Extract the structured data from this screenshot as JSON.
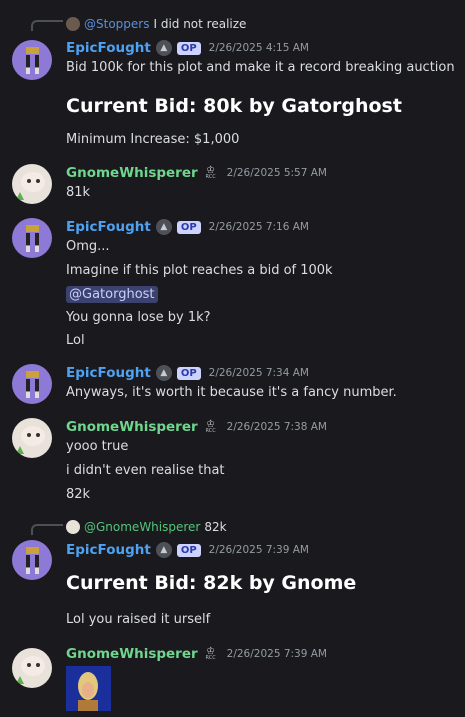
{
  "messages": [
    {
      "reply": {
        "name": "@Stoppers",
        "text": "I did not realize"
      },
      "author": "EpicFought",
      "badge": "OP",
      "time": "2/26/2025 4:15 AM",
      "lines": [
        "Bid 100k for this plot and make it a record breaking auction"
      ],
      "heading": "Current Bid: 80k by Gatorghost",
      "after": "Minimum Increase: $1,000"
    },
    {
      "author": "GnomeWhisperer",
      "tag": "RCC",
      "time": "2/26/2025 5:57 AM",
      "lines": [
        "81k"
      ]
    },
    {
      "author": "EpicFought",
      "badge": "OP",
      "time": "2/26/2025 7:16 AM",
      "lines": [
        "Omg...",
        "Imagine if this plot reaches a bid of 100k",
        "@Gatorghost",
        "You gonna lose by 1k?",
        "Lol"
      ]
    },
    {
      "author": "EpicFought",
      "badge": "OP",
      "time": "2/26/2025 7:34 AM",
      "lines": [
        "Anyways, it's worth it because it's a fancy number."
      ]
    },
    {
      "author": "GnomeWhisperer",
      "tag": "RCC",
      "time": "2/26/2025 7:38 AM",
      "lines": [
        "yooo true",
        "i didn't even realise that",
        "82k"
      ]
    },
    {
      "reply": {
        "name": "@GnomeWhisperer",
        "text": "82k"
      },
      "author": "EpicFought",
      "badge": "OP",
      "time": "2/26/2025 7:39 AM",
      "heading": "Current Bid: 82k by Gnome",
      "after": "Lol you raised it urself"
    },
    {
      "author": "GnomeWhisperer",
      "tag": "RCC",
      "time": "2/26/2025 7:39 AM"
    }
  ],
  "colors": {
    "background": "#1a1a1e",
    "epic_name": "#4ea2f1",
    "gnome_name": "#6fd68d",
    "op_badge": "#cdd3ff"
  }
}
